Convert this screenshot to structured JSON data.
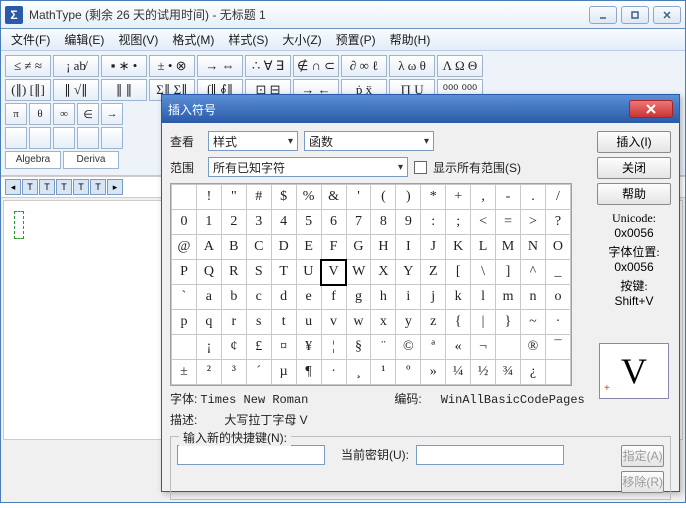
{
  "window": {
    "app_icon": "Σ",
    "title": "MathType (剩余 26 天的试用时间) - 无标题 1"
  },
  "menus": [
    "文件(F)",
    "编辑(E)",
    "视图(V)",
    "格式(M)",
    "样式(S)",
    "大小(Z)",
    "预置(P)",
    "帮助(H)"
  ],
  "toolbar": {
    "row1": [
      "≤ ≠ ≈",
      "¡ ab̸",
      "▪ ∗ •",
      "± • ⊗",
      "→ ⇔",
      "∴ ∀ ∃",
      "∉ ∩ ⊂",
      "∂ ∞ ℓ",
      "λ ω θ",
      "Λ Ω Θ"
    ],
    "row2": [
      "(∥) [∥]",
      "∥ √∥",
      "∥ ∥",
      "Σ∥ Σ∥",
      "∫∥ ∮∥",
      "⊡ ⊟",
      "→ ←",
      "ṗ ẍ",
      "∏ Ụ",
      "⁰⁰⁰ ⁰⁰⁰"
    ],
    "row3": [
      "π",
      "θ",
      "∞",
      "∈",
      "→"
    ],
    "row4": [
      "",
      "",
      "",
      "",
      ""
    ],
    "tabs": [
      "Algebra",
      "Deriva"
    ]
  },
  "ruler_btns": [
    "◂",
    "T",
    "T",
    "T",
    "T",
    "T",
    "▸"
  ],
  "dialog": {
    "title": "插入符号",
    "look_label": "查看",
    "look_combo1": "样式",
    "look_combo2": "函数",
    "range_label": "范围",
    "range_combo": "所有已知字符",
    "show_all": "显示所有范围(S)",
    "btn_insert": "插入(I)",
    "btn_close": "关闭",
    "btn_help": "帮助",
    "unicode_label": "Unicode:",
    "unicode_val": "0x0056",
    "pos_label": "字体位置:",
    "pos_val": "0x0056",
    "key_label": "按键:",
    "key_val": "Shift+V",
    "preview_char": "V",
    "font_line_label": "字体:",
    "font_line_val": "Times New Roman",
    "encoding_label": "编码:",
    "encoding_val": "WinAllBasicCodePages",
    "desc_label": "描述:",
    "desc_val": "大写拉丁字母 V",
    "grp_left": "输入新的快捷键(N):",
    "grp_right": "当前密钥(U):",
    "btn_assign": "指定(A)",
    "btn_remove": "移除(R)"
  },
  "chart_data": {
    "type": "table",
    "title": "Character grid",
    "selected": "V",
    "rows": [
      [
        "",
        "!",
        "\"",
        "#",
        "$",
        "%",
        "&",
        "'",
        "(",
        ")",
        "*",
        "+",
        ",",
        "-",
        ".",
        "/"
      ],
      [
        "0",
        "1",
        "2",
        "3",
        "4",
        "5",
        "6",
        "7",
        "8",
        "9",
        ":",
        ";",
        "<",
        "=",
        ">",
        "?"
      ],
      [
        "@",
        "A",
        "B",
        "C",
        "D",
        "E",
        "F",
        "G",
        "H",
        "I",
        "J",
        "K",
        "L",
        "M",
        "N",
        "O"
      ],
      [
        "P",
        "Q",
        "R",
        "S",
        "T",
        "U",
        "V",
        "W",
        "X",
        "Y",
        "Z",
        "[",
        "\\",
        "]",
        "^",
        "_"
      ],
      [
        "`",
        "a",
        "b",
        "c",
        "d",
        "e",
        "f",
        "g",
        "h",
        "i",
        "j",
        "k",
        "l",
        "m",
        "n",
        "o"
      ],
      [
        "p",
        "q",
        "r",
        "s",
        "t",
        "u",
        "v",
        "w",
        "x",
        "y",
        "z",
        "{",
        "|",
        "}",
        "~",
        "·"
      ],
      [
        " ",
        "¡",
        "¢",
        "£",
        "¤",
        "¥",
        "¦",
        "§",
        "¨",
        "©",
        "ª",
        "«",
        "¬",
        "­",
        "®",
        "¯"
      ],
      [
        "±",
        "²",
        "³",
        "´",
        "µ",
        "¶",
        "·",
        "¸",
        "¹",
        "º",
        "»",
        "¼",
        "½",
        "¾",
        "¿",
        ""
      ]
    ]
  }
}
